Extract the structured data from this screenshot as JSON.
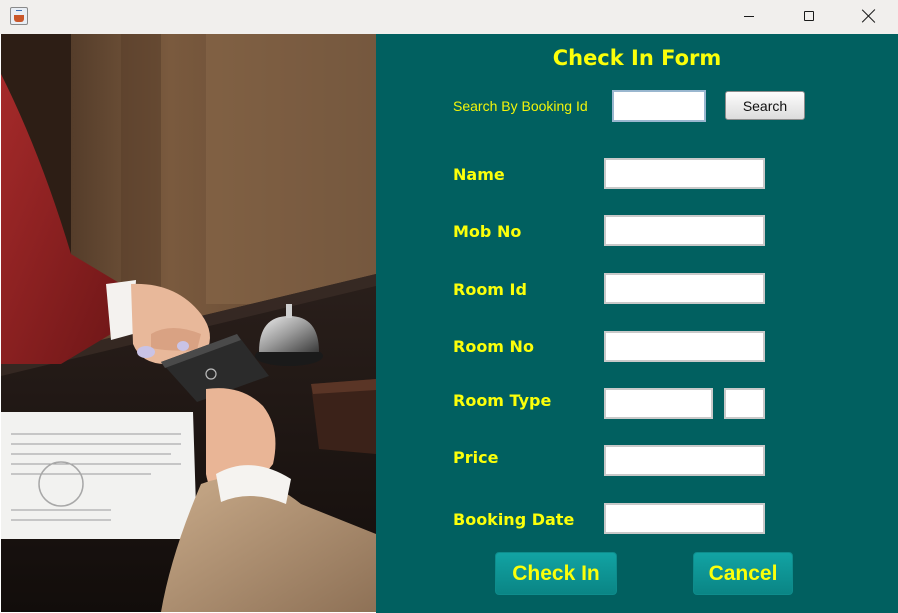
{
  "window": {
    "icon": "java-coffee-cup-icon",
    "controls": [
      "minimize-icon",
      "maximize-icon",
      "close-icon"
    ]
  },
  "image": {
    "subject": "hotel reception card handover photo",
    "colors": {
      "sleeve": "#8e1f20",
      "wall": "#6a4a31",
      "counter": "#1b1412",
      "paper": "#f2f2f0"
    }
  },
  "form": {
    "title": "Check In Form",
    "search": {
      "label": "Search By Booking Id",
      "value": "",
      "button": "Search"
    },
    "fields": {
      "name": {
        "label": "Name",
        "value": ""
      },
      "mob_no": {
        "label": "Mob No",
        "value": ""
      },
      "room_id": {
        "label": "Room Id",
        "value": ""
      },
      "room_no": {
        "label": "Room No",
        "value": ""
      },
      "room_type": {
        "label": "Room Type",
        "value": "",
        "value2": ""
      },
      "price": {
        "label": "Price",
        "value": ""
      },
      "booking_date": {
        "label": "Booking Date",
        "value": ""
      }
    },
    "buttons": {
      "check_in": "Check In",
      "cancel": "Cancel"
    },
    "colors": {
      "panel": "#016060",
      "label": "#fbff0a",
      "button": "#0a9a9a"
    }
  }
}
